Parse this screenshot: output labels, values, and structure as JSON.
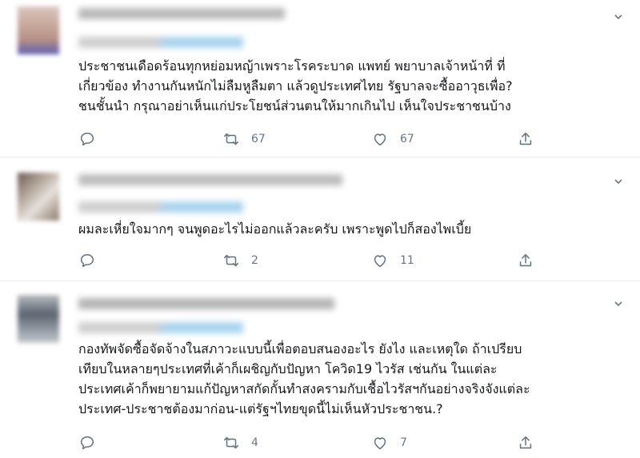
{
  "replies": [
    {
      "text_lines": [
        "ประชาชนเดือดร้อนทุกหย่อมหญ้าเพราะโรคระบาด  แพทย์ พยาบาลเจ้าหน้าที่ ที่",
        "เกี่ยวข้อง ทำงานกันหนักไม่ลืมหูลืมตา  แล้วดูประเทศไทย รัฐบาลจะซื้ออาวุธเพื่อ?",
        "  ชนชั้นนำ กรุณาอย่าเห็นแก่ประโยชน์ส่วนตนให้มากเกินไป เห็นใจประชาชนบ้าง"
      ],
      "retweets": "67",
      "likes": "67"
    },
    {
      "text_lines": [
        "ผมละเหี่ยใจมากๆ จนพูดอะไรไม่ออกแล้วละครับ เพราะพูดไปก็สองไพเบี้ย"
      ],
      "retweets": "2",
      "likes": "11"
    },
    {
      "text_lines": [
        "กองทัพจัดซื้อจัดจ้างในสภาวะแบบนี้เพื่อตอบสนองอะไร ยังไง และเหตุใด ถ้าเปรียบ",
        "เทียบในหลายๆประเทศที่เค้าก็เผชิญกับปัญหา โควิด19 ไวรัส เช่นกัน ในแต่ละ",
        "ประเทศเค้าก็พยายามแก้ปัญหาสกัดกั้นทำสงครามกับเชื้อไวรัสฯกันอย่างจริงจังแต่ละ",
        "ประเทศ-ประชาชต้องมาก่อน-แต่รัฐฯไทยขุดนี้ไม่เห็นหัวประชาชน.?"
      ],
      "retweets": "4",
      "likes": "7"
    }
  ],
  "icons": {
    "reply": "comment-icon",
    "retweet": "retweet-icon",
    "like": "heart-icon",
    "share": "share-icon",
    "menu": "chevron-down-icon"
  },
  "colors": {
    "action_gray": "#657786",
    "divider": "#e6ecf0",
    "text": "#14171a"
  }
}
